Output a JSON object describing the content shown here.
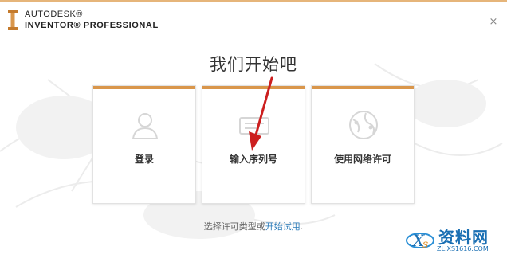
{
  "window": {
    "brand_line1": "AUTODESK®",
    "brand_line2": "INVENTOR® PROFESSIONAL",
    "close_glyph": "×"
  },
  "main": {
    "title": "我们开始吧",
    "cards": [
      {
        "label": "登录",
        "icon": "user-icon"
      },
      {
        "label": "输入序列号",
        "icon": "serial-number-icon"
      },
      {
        "label": "使用网络许可",
        "icon": "network-globe-icon"
      }
    ],
    "footer_prefix": "选择许可类型或",
    "footer_link": "开始试用",
    "footer_suffix": "."
  },
  "watermark": {
    "text": "资料网",
    "url": "ZL.XS1616.COM"
  },
  "colors": {
    "accent": "#d9964b",
    "top_bar": "#e6b57a",
    "link": "#2a7ab8",
    "arrow": "#cc1f1f",
    "watermark": "#1a6fb3"
  }
}
